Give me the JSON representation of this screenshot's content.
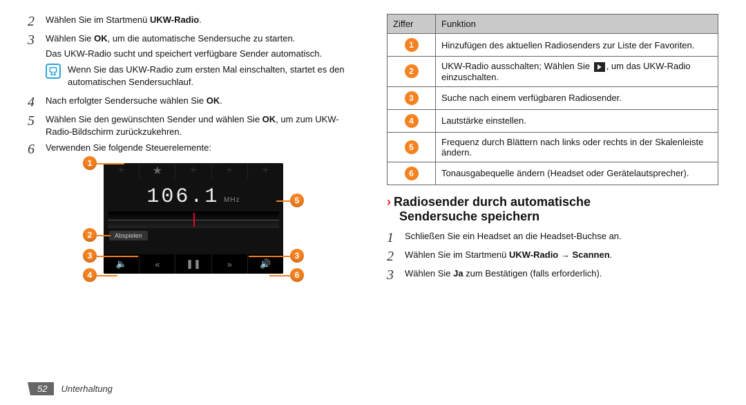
{
  "left": {
    "step2": {
      "num": "2",
      "pre": "Wählen Sie im Startmenü ",
      "bold": "UKW-Radio",
      "post": "."
    },
    "step3": {
      "num": "3",
      "pre": "Wählen Sie ",
      "bold": "OK",
      "post": ", um die automatische Sendersuche zu starten."
    },
    "step3_extra": "Das UKW-Radio sucht und speichert verfügbare Sender automatisch.",
    "note": "Wenn Sie das UKW-Radio zum ersten Mal einschalten, startet es den automatischen Sendersuchlauf.",
    "step4": {
      "num": "4",
      "pre": "Nach erfolgter Sendersuche wählen Sie ",
      "bold": "OK",
      "post": "."
    },
    "step5": {
      "num": "5",
      "pre": "Wählen Sie den gewünschten Sender und wählen Sie ",
      "bold": "OK",
      "post": ", um zum UKW-Radio-Bildschirm zurückzukehren."
    },
    "step6": {
      "num": "6",
      "text": "Verwenden Sie folgende Steuerelemente:"
    },
    "radio": {
      "freq": "106.1",
      "unit": "MHz",
      "play_label": "Abspielen"
    }
  },
  "table": {
    "head_num": "Ziffer",
    "head_func": "Funktion",
    "rows": [
      {
        "n": "1",
        "text_a": "Hinzufügen des aktuellen Radiosenders zur Liste der Favoriten."
      },
      {
        "n": "2",
        "text_a": "UKW-Radio ausschalten; Wählen Sie ",
        "text_b": ", um das UKW-Radio einzuschalten.",
        "has_icon": true
      },
      {
        "n": "3",
        "text_a": "Suche nach einem verfügbaren Radiosender."
      },
      {
        "n": "4",
        "text_a": "Lautstärke einstellen."
      },
      {
        "n": "5",
        "text_a": "Frequenz durch Blättern nach links oder rechts in der Skalenleiste ändern."
      },
      {
        "n": "6",
        "text_a": "Tonausgabequelle ändern (Headset oder Gerätelautsprecher)."
      }
    ]
  },
  "right": {
    "heading_a": "Radiosender durch automatische",
    "heading_b": "Sendersuche speichern",
    "step1": {
      "num": "1",
      "text": "Schließen Sie ein Headset an die Headset-Buchse an."
    },
    "step2": {
      "num": "2",
      "pre": "Wählen Sie im Startmenü ",
      "bold": "UKW-Radio → Scannen",
      "post": "."
    },
    "step3": {
      "num": "3",
      "pre": "Wählen Sie ",
      "bold": "Ja",
      "post": " zum Bestätigen (falls erforderlich)."
    }
  },
  "footer": {
    "page": "52",
    "section": "Unterhaltung"
  },
  "chevron": "›"
}
